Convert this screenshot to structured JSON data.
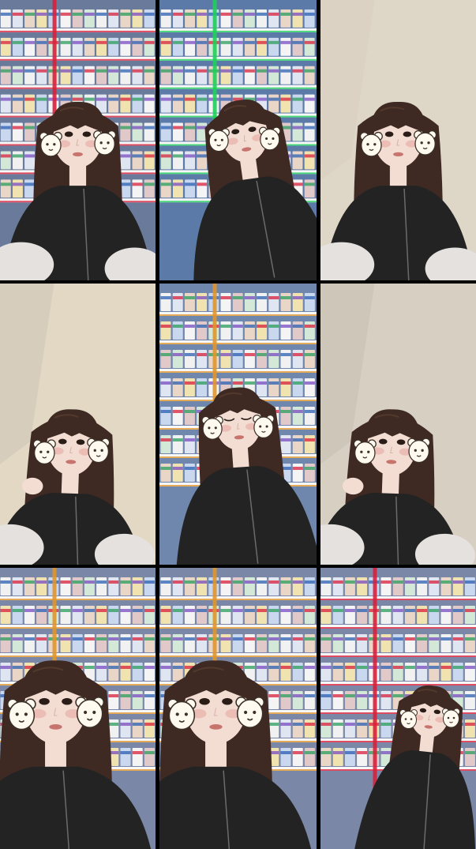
{
  "grid": {
    "columns": 3,
    "rows": 3
  },
  "tiles": [
    {
      "name": "tile-1",
      "scene": "store-shelves",
      "wall": "#6a7a9a",
      "shelf_accent": "#d8203c",
      "pose": "sitting-front",
      "sticker": "bear-sticker"
    },
    {
      "name": "tile-2",
      "scene": "store-shelves",
      "wall": "#5c7aa8",
      "shelf_accent": "#1fcf5a",
      "pose": "head-tilt-left",
      "sticker": "bear-sticker"
    },
    {
      "name": "tile-3",
      "scene": "plain-wall",
      "wall": "#d9d0c2",
      "shelf_accent": "#cfc6b8",
      "pose": "sitting-front",
      "sticker": "bear-sticker"
    },
    {
      "name": "tile-4",
      "scene": "plain-wall",
      "wall": "#ddd3bf",
      "shelf_accent": "#b9b0a2",
      "pose": "hand-in-hair",
      "sticker": "bear-sticker"
    },
    {
      "name": "tile-5",
      "scene": "store-shelves",
      "wall": "#6f86ad",
      "shelf_accent": "#e0962e",
      "pose": "eyes-closed",
      "sticker": "bear-sticker"
    },
    {
      "name": "tile-6",
      "scene": "plain-wall",
      "wall": "#cfc8bd",
      "shelf_accent": "#b5ad9f",
      "pose": "hand-in-hair",
      "sticker": "bear-sticker"
    },
    {
      "name": "tile-7",
      "scene": "store-shelves",
      "wall": "#7a87a6",
      "shelf_accent": "#e0962e",
      "pose": "close-up",
      "sticker": "bear-sticker"
    },
    {
      "name": "tile-8",
      "scene": "store-shelves",
      "wall": "#7a87a6",
      "shelf_accent": "#e0962e",
      "pose": "close-up",
      "sticker": "bear-sticker"
    },
    {
      "name": "tile-9",
      "scene": "store-shelves",
      "wall": "#7a87a6",
      "shelf_accent": "#d8203c",
      "pose": "head-tilt-right",
      "sticker": "bear-sticker"
    }
  ],
  "colors": {
    "hair": "#3e2a22",
    "hair_highlight": "#5d3f30",
    "skin": "#f3ddd2",
    "blush": "#e8a8a2",
    "lips": "#c7746f",
    "jacket": "#232323",
    "pants": "#e4e1de",
    "sticker": "#fffaf0",
    "sticker_outline": "#3a3028"
  }
}
